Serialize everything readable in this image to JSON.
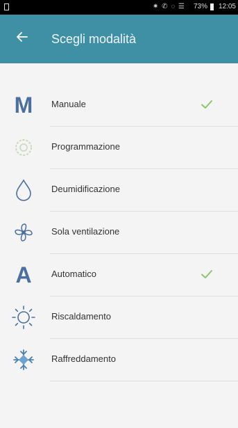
{
  "status_bar": {
    "icons": "✷ ✆ ◌ ☰",
    "battery": "73%",
    "time": "12:05"
  },
  "header": {
    "back_icon": "arrow-left-icon",
    "title": "Scegli modalità"
  },
  "modes": [
    {
      "label": "Manuale",
      "icon": "letter-m-icon",
      "icon_text": "M",
      "selected": true
    },
    {
      "label": "Programmazione",
      "icon": "schedule-icon",
      "selected": false
    },
    {
      "label": "Deumidificazione",
      "icon": "water-drop-icon",
      "selected": false
    },
    {
      "label": "Sola ventilazione",
      "icon": "fan-icon",
      "selected": false
    },
    {
      "label": "Automatico",
      "icon": "letter-a-icon",
      "icon_text": "A",
      "selected": true
    },
    {
      "label": "Riscaldamento",
      "icon": "sun-icon",
      "selected": false
    },
    {
      "label": "Raffreddamento",
      "icon": "snowflake-icon",
      "selected": false
    }
  ],
  "colors": {
    "app_bar": "#3f90a4",
    "icon_blue": "#4a6fa0",
    "check_green": "#8cc56a"
  }
}
